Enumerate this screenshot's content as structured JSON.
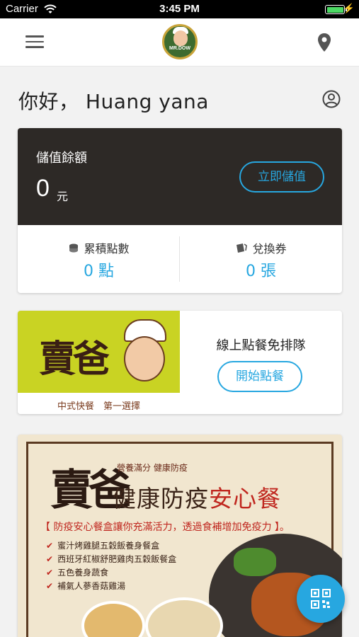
{
  "status_bar": {
    "carrier": "Carrier",
    "time": "3:45 PM",
    "battery_level": 1.0,
    "battery_color": "#4cd964"
  },
  "navbar": {
    "logo_text": "MR.DOW",
    "menu_icon": "hamburger-menu-icon",
    "location_icon": "map-pin-icon"
  },
  "greeting": {
    "text": "你好， Huang yana",
    "profile_icon": "user-circle-icon"
  },
  "wallet": {
    "balance_label": "儲值餘額",
    "balance_value": "0",
    "balance_unit": "元",
    "topup_button": "立即儲值",
    "points_label": "累積點數",
    "points_value": "0 點",
    "coupons_label": "兌換券",
    "coupons_value": "0 張"
  },
  "order_card": {
    "image_tagline": "中式快餐　第一選擇",
    "title": "線上點餐免排隊",
    "order_button": "開始點餐"
  },
  "promo": {
    "subtitle": "營養滿分 健康防疫",
    "headline_plain": "健康防疫",
    "headline_red": "安心餐",
    "description": "【 防疫安心餐盒讓你充滿活力，透過食補增加免疫力 】。",
    "items": [
      "蜜汁烤雞腿五穀飯養身餐盒",
      "西班牙紅椒舒肥雞肉五穀飯餐盒",
      "五色養身蔬食",
      "補氣人蔘香菇雞湯"
    ]
  },
  "fab": {
    "icon": "qr-code-icon"
  },
  "colors": {
    "accent": "#27a7e0",
    "dark_card": "#2d2926",
    "brand_green": "#c9d323"
  }
}
